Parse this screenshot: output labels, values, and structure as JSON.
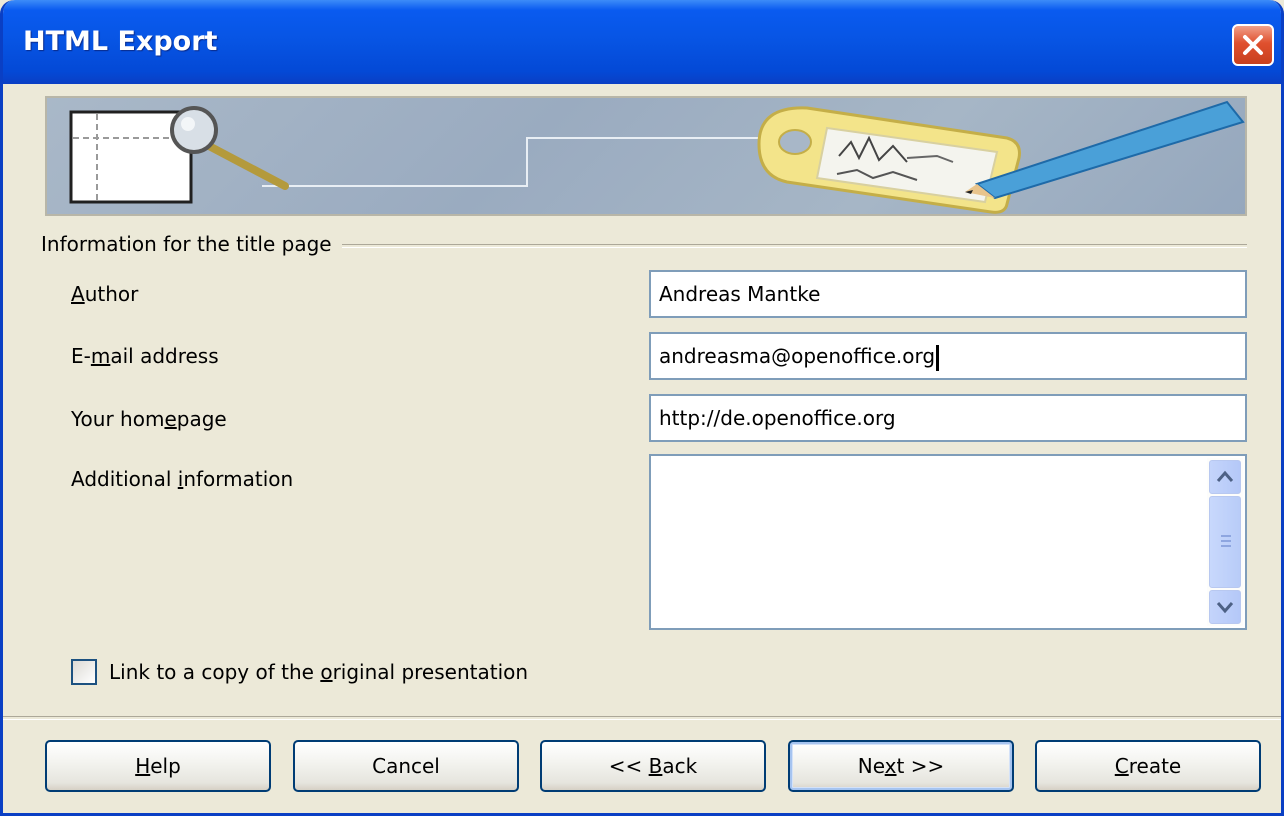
{
  "window": {
    "title": "HTML Export",
    "close_icon": "close-icon"
  },
  "banner": {
    "icons": [
      "page-preview-icon",
      "magnifier-icon",
      "key-tag-icon",
      "pencil-icon"
    ]
  },
  "title_page_group": {
    "label": "Information for the title page",
    "fields": [
      {
        "label_pre": "",
        "label_key": "A",
        "label_post": "uthor",
        "value": "Andreas Mantke"
      },
      {
        "label_pre": "E-",
        "label_key": "m",
        "label_post": "ail address",
        "value": "andreasma@openoffice.org"
      },
      {
        "label_pre": "Your hom",
        "label_key": "e",
        "label_post": "page",
        "value": "http://de.openoffice.org"
      }
    ],
    "additional": {
      "label_pre": "Additional ",
      "label_key": "i",
      "label_post": "nformation",
      "value": ""
    }
  },
  "link_checkbox": {
    "label_pre": "Link to a copy of the ",
    "label_key": "o",
    "label_post": "riginal presentation",
    "checked": false
  },
  "buttons": {
    "help": {
      "pre": "",
      "key": "H",
      "post": "elp"
    },
    "cancel": {
      "label": "Cancel"
    },
    "back": {
      "pre": "<< ",
      "key": "B",
      "post": "ack"
    },
    "next": {
      "pre": "Ne",
      "key": "x",
      "post": "t >>"
    },
    "create": {
      "pre": "",
      "key": "C",
      "post": "reate"
    }
  },
  "colors": {
    "titlebar": "#0754e3",
    "dialog_bg": "#ece9d8",
    "input_border": "#7f9db9",
    "button_border": "#003c74",
    "close_button": "#e0502e"
  }
}
